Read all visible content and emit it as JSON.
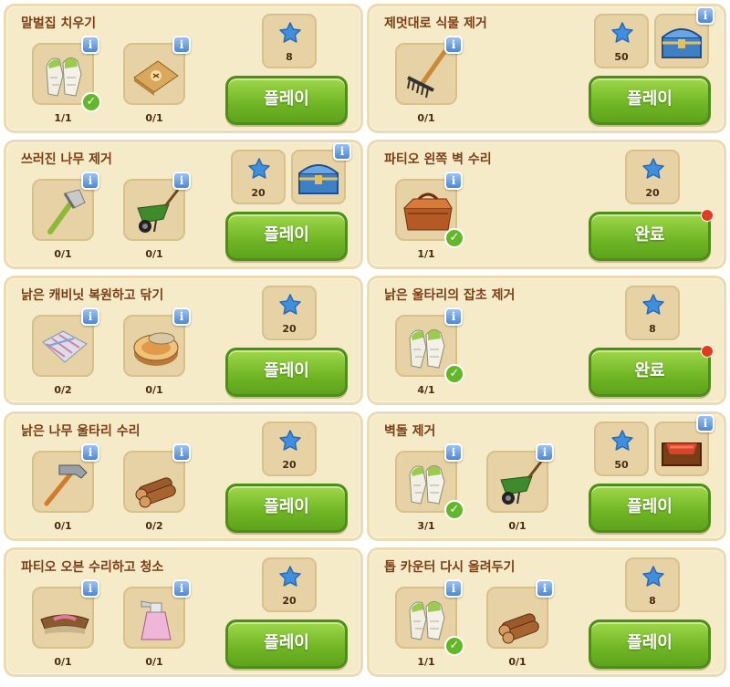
{
  "button_play": "플레이",
  "button_done": "완료",
  "info_glyph": "i",
  "check_glyph": "✓",
  "colors": {
    "card_bg": "#f6ebc9",
    "title": "#7a3e16",
    "button_green": "#6fb524",
    "star_blue": "#3f8ee0",
    "info_blue": "#4d87d6",
    "notification_red": "#e23a1e"
  },
  "tasks": [
    {
      "title": "말벌집 치우기",
      "requirements": [
        {
          "icon": "gloves-icon",
          "count": "1/1",
          "complete": true
        },
        {
          "icon": "fertilizer-bag-icon",
          "count": "0/1",
          "complete": false
        }
      ],
      "stars": "8",
      "chest": null,
      "button": "play"
    },
    {
      "title": "제멋대로 식물 제거",
      "requirements": [
        {
          "icon": "rake-icon",
          "count": "0/1",
          "complete": false
        }
      ],
      "stars": "50",
      "chest": "blue-chest-icon",
      "button": "play"
    },
    {
      "title": "쓰러진 나무 제거",
      "requirements": [
        {
          "icon": "axe-icon",
          "count": "0/1",
          "complete": false
        },
        {
          "icon": "wheelbarrow-icon",
          "count": "0/1",
          "complete": false
        }
      ],
      "stars": "20",
      "chest": "blue-chest-icon",
      "button": "play"
    },
    {
      "title": "파티오 왼쪽 벽 수리",
      "requirements": [
        {
          "icon": "toolbox-icon",
          "count": "1/1",
          "complete": true
        }
      ],
      "stars": "20",
      "chest": null,
      "button": "done"
    },
    {
      "title": "낡은 캐비닛 복원하고 닦기",
      "requirements": [
        {
          "icon": "cloth-icon",
          "count": "0/2",
          "complete": false
        },
        {
          "icon": "polish-tin-icon",
          "count": "0/1",
          "complete": false
        }
      ],
      "stars": "20",
      "chest": null,
      "button": "play"
    },
    {
      "title": "낡은 울타리의 잡초 제거",
      "requirements": [
        {
          "icon": "gloves-icon",
          "count": "4/1",
          "complete": true
        }
      ],
      "stars": "8",
      "chest": null,
      "button": "done"
    },
    {
      "title": "낡은 나무 울타리 수리",
      "requirements": [
        {
          "icon": "hammer-icon",
          "count": "0/1",
          "complete": false
        },
        {
          "icon": "logs-icon",
          "count": "0/2",
          "complete": false
        }
      ],
      "stars": "20",
      "chest": null,
      "button": "play"
    },
    {
      "title": "벽돌 제거",
      "requirements": [
        {
          "icon": "gloves-icon",
          "count": "3/1",
          "complete": true
        },
        {
          "icon": "wheelbarrow-icon",
          "count": "0/1",
          "complete": false
        }
      ],
      "stars": "50",
      "chest": "red-chest-icon",
      "button": "play"
    },
    {
      "title": "파티오 오븐 수리하고 청소",
      "requirements": [
        {
          "icon": "brush-icon",
          "count": "0/1",
          "complete": false
        },
        {
          "icon": "spray-bottle-icon",
          "count": "0/1",
          "complete": false
        }
      ],
      "stars": "20",
      "chest": null,
      "button": "play"
    },
    {
      "title": "톱 카운터 다시 올려두기",
      "requirements": [
        {
          "icon": "gloves-icon",
          "count": "1/1",
          "complete": true
        },
        {
          "icon": "logs-icon",
          "count": "0/1",
          "complete": false
        }
      ],
      "stars": "8",
      "chest": null,
      "button": "play"
    }
  ]
}
